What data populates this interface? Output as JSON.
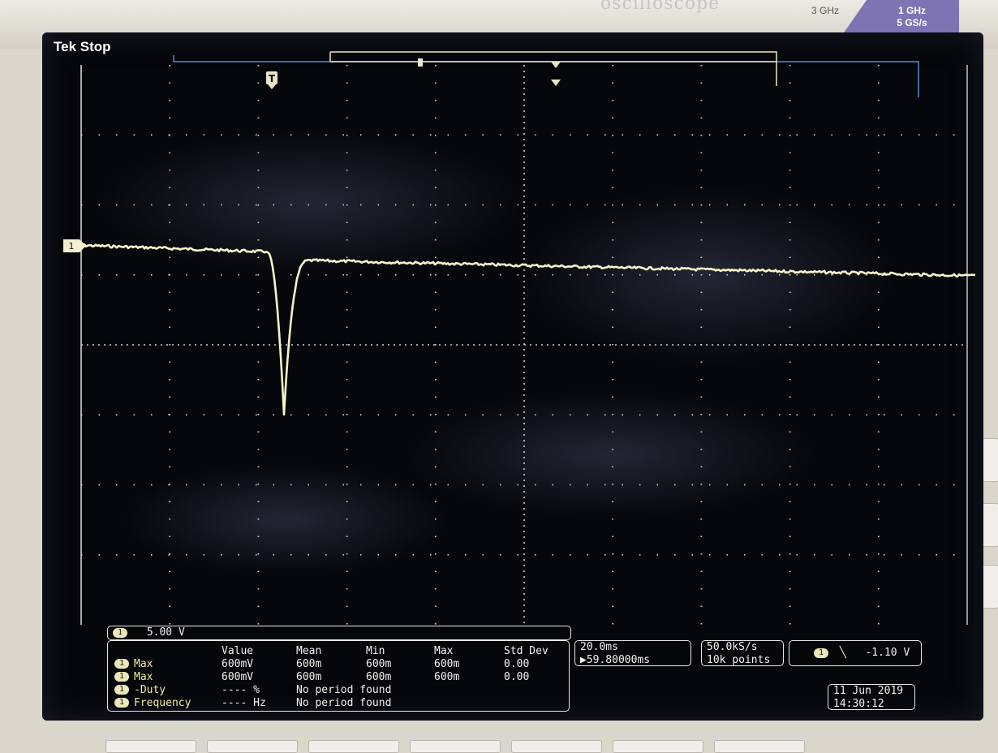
{
  "device": {
    "brand_text": "oscilloscope",
    "bandwidth_label": "3 GHz",
    "spec_bandwidth": "1 GHz",
    "spec_sample_rate": "5 GS/s"
  },
  "status": {
    "brand": "Tek",
    "acq_state": "Stop"
  },
  "channel": {
    "number": "1",
    "scale": "5.00 V"
  },
  "markers": {
    "trigger_marker": "T",
    "ground_marker": "1"
  },
  "measurements": {
    "headers": [
      "Value",
      "Mean",
      "Min",
      "Max",
      "Std Dev"
    ],
    "rows": [
      {
        "ch": "1",
        "name": "Max",
        "value": "600mV",
        "mean": "600m",
        "min": "600m",
        "max": "600m",
        "std": "0.00"
      },
      {
        "ch": "1",
        "name": "Max",
        "value": "600mV",
        "mean": "600m",
        "min": "600m",
        "max": "600m",
        "std": "0.00"
      },
      {
        "ch": "1",
        "name": "-Duty",
        "value": "---- %",
        "mean": "No period found",
        "min": "",
        "max": "",
        "std": ""
      },
      {
        "ch": "1",
        "name": "Frequency",
        "value": "---- Hz",
        "mean": "No period found",
        "min": "",
        "max": "",
        "std": ""
      }
    ]
  },
  "timebase": {
    "scale": "20.0ms",
    "position": "▶59.80000ms"
  },
  "acquisition": {
    "sample_rate": "50.0kS/s",
    "record_length": "10k points"
  },
  "trigger": {
    "source": "1",
    "slope": "╲",
    "level": "-1.10 V"
  },
  "datetime": {
    "date": "11 Jun 2019",
    "time": "14:30:12"
  },
  "colors": {
    "trace": "#f6f3c8",
    "screen": "#06070b",
    "accent": "#7e73b3"
  }
}
